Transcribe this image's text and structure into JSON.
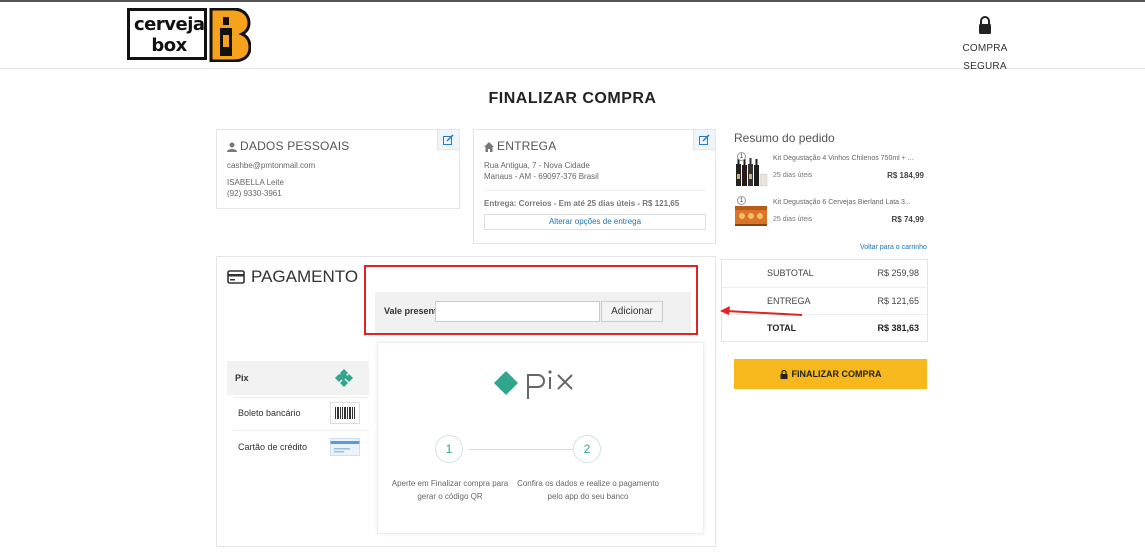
{
  "header": {
    "logo_text": "cerveja box",
    "logo_line1": "cerveja",
    "logo_line2": "box",
    "secure_label": "COMPRA SEGURA",
    "lock_icon": "lock-icon"
  },
  "page_title": "FINALIZAR COMPRA",
  "personal": {
    "title": "DADOS PESSOAIS",
    "email": "cashbe@pmtonmail.com",
    "name": "ISABELLA Leite",
    "phone": "(92) 9330-3961"
  },
  "delivery": {
    "title": "ENTREGA",
    "address_line1": "Rua Antigua, 7 - Nova Cidade",
    "address_line2": "Manaus - AM - 69097-376 Brasil",
    "shipping": "Entrega: Correios - Em até 25 dias úteis - R$ 121,65",
    "change_label": "Alterar opções de entrega"
  },
  "summary": {
    "title": "Resumo do pedido",
    "items": [
      {
        "qty": "1",
        "name": "Kit Degustação 4 Vinhos Chilenos 750ml + ...",
        "ship": "25 dias úteis",
        "price": "R$ 184,99"
      },
      {
        "qty": "1",
        "name": "Kit Degustação 6 Cervejas Bierland Lata 3...",
        "ship": "25 dias úteis",
        "price": "R$ 74,99"
      }
    ],
    "back_link": "Voltar para o carrinho"
  },
  "totals": {
    "subtotal_label": "SUBTOTAL",
    "subtotal_value": "R$ 259,98",
    "delivery_label": "ENTREGA",
    "delivery_value": "R$ 121,65",
    "total_label": "TOTAL",
    "total_value": "R$ 381,63"
  },
  "finalize_label": "FINALIZAR COMPRA",
  "payment": {
    "title": "PAGAMENTO",
    "voucher_label": "Vale presente",
    "voucher_value": "",
    "voucher_button": "Adicionar",
    "methods": [
      {
        "label": "Pix",
        "icon": "pix-icon"
      },
      {
        "label": "Boleto bancário",
        "icon": "barcode-icon"
      },
      {
        "label": "Cartão de crédito",
        "icon": "credit-card-icon"
      }
    ],
    "pix": {
      "logo_text": "pix",
      "step1_num": "1",
      "step2_num": "2",
      "step1_text": "Aperte em Finalizar compra para gerar o código QR",
      "step2_text": "Confira os dados e realize o pagamento pelo app do seu banco"
    }
  },
  "colors": {
    "accent": "#f6b81c",
    "link": "#1a73b8",
    "highlight": "#e02424",
    "pix": "#32a58e"
  }
}
